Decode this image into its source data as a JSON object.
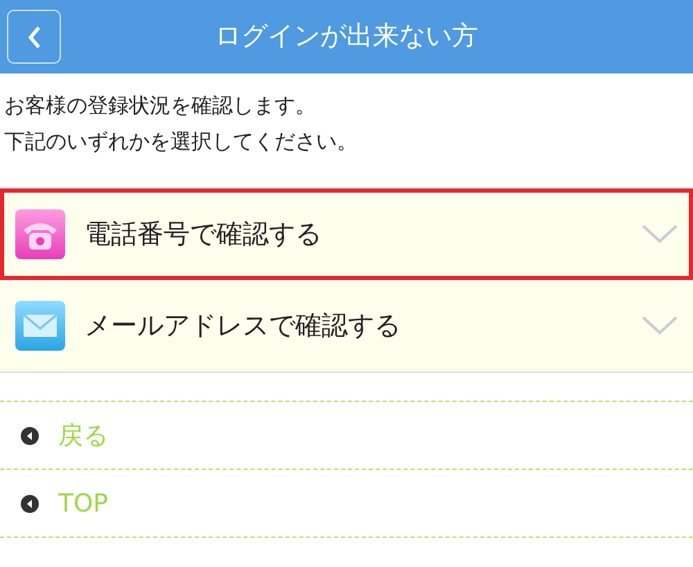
{
  "header": {
    "title": "ログインが出来ない方"
  },
  "intro": [
    "お客様の登録状況を確認します。",
    "下記のいずれかを選択してください。"
  ],
  "options": [
    {
      "kind": "phone",
      "label": "電話番号で確認する",
      "highlighted": true
    },
    {
      "kind": "mail",
      "label": "メールアドレスで確認する",
      "highlighted": false
    }
  ],
  "links": [
    {
      "label": "戻る"
    },
    {
      "label": "TOP"
    }
  ]
}
